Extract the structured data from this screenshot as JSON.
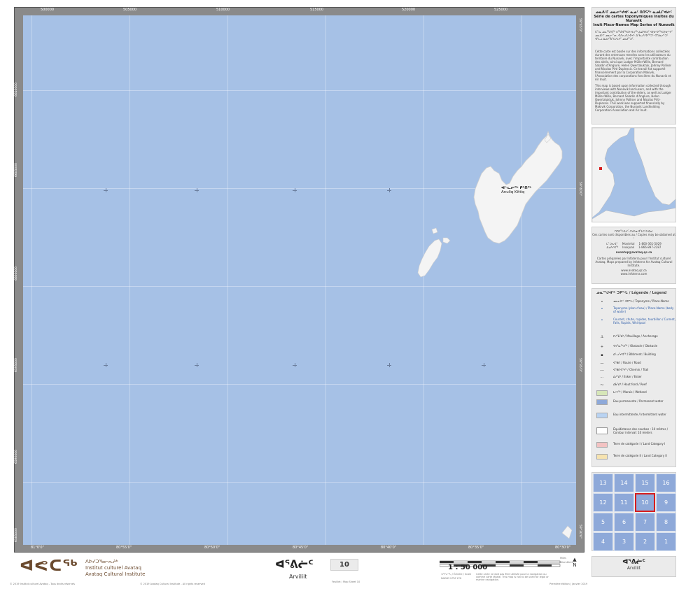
{
  "map": {
    "top_ticks": [
      "500000",
      "505000",
      "510000",
      "515000",
      "520000",
      "525000"
    ],
    "bottom_ticks": [
      "81°0'0\"",
      "80°55'0\"",
      "80°50'0\"",
      "80°45'0\"",
      "80°40'0\"",
      "80°35'0\"",
      "80°30'0\""
    ],
    "left_ticks": [
      "6610000",
      "6605000",
      "6600000",
      "6595000",
      "6590000",
      "6585000",
      "6580000"
    ],
    "right_ticks": [
      "59°45'0\"",
      "59°40'0\"",
      "59°35'0\"",
      "59°30'0\""
    ],
    "place_syllabic": "ᐊᓪᓚᓕᖅ ᑭᑦᑎᖅ",
    "place_roman": "Anuliq Kittiq"
  },
  "panel": {
    "series_title_syllabic": "ᓄᓇᕕᒻᒥ ᓄᓇᓕᕐᔪᐊᑦ ᓇᓄᑦ ᑎᑎᕋᖅ ᓇᓄᒪᒋᐊᓖᑦ",
    "series_title_fr": "Série de cartes toponymiques inuites du Nunavik",
    "series_title_en": "Inuit Place-Names Map Series of Nunavik",
    "intro_syllabic": "ᑖᓐᓇ ᓄᓇᙳᐊᖅ ᐱᙳᐊᖅᑕᐅᓯᒪᔪᖅ ᐃᓄᒃᑎᑐᑦ ᐊᑎᓕᐅᖅᑕᐅᓂᖏᑦ ᓄᓇᕕᒻᒥ ᓄᓇᓕᓐᓂ, ᐊᐱᕆᓯᒪᔭᐅᔪᑦ ᐃᖃᓗᒃᓯᐅᖅᑐᑦ ᐊᖑᓇᓱᑦᑐᑦ ᐊᒻᒪᓗ ᐃᓅᓯᖃᑦᑕᓯᒪᔪᑦ ᓄᓇᒦᑦᑐᑦ.",
    "intro_fr": "Cette carte est basée sur des informations collectées durant des entrevues menées avec les utilisateurs du territoire du Nunavik, avec l'importante contribution des aînés, ainsi que Ludger Müller-Wille, Bernard Saladin d'Anglure, Helen Qwertaluktuk, Johnny Palliser and Nicolas Pirti-Duplessis. Ce travail fut supporté financièrement par la Corporation Makivik, l'Association des corporations foncières du Nunavik et Air Inuit.",
    "intro_en": "This map is based upon information collected through interviews with Nunavik land users, and with the important contribution of the elders, as well as Ludger Müller-Wille, Bernard Saladin d'Anglure, Helen Qwertaluktuk, Johnny Palliser and Nicolas Pirti-Duplessis. This work was supported financially by Makivik Corporation, the Nunavik Landholding Corporation Association and Air Inuit.",
    "obtain_syllabic": "ᑎᑎᕋᖅᓯᒪᔪᑦ ᐱᔭᐅᓂᐊᕐᒪᑕ ᐅᕙᓂ:",
    "obtain_bi": "Ces cartes sont disponibles au / Copies may be obtained at :",
    "contact_1_label": "ᒪᓐᑐᕆᐊᓪ",
    "contact_1_city": "Montréal",
    "contact_1_phone": "1-800-361-5029",
    "contact_2_label": "ᐃᓄᒃᔪᐊᖅ",
    "contact_2_city": "Inukjuak",
    "contact_2_phone": "1-866-897-2287",
    "email": "nunatop@avataq.qc.ca",
    "prepared_by": "Cartes préparées par Infoterra pour l'Institut culturel Avataq. Maps prepared by Infoterra for Avataq Cultural Institute.",
    "website_1": "www.avataq.qc.ca",
    "website_2": "www.infoterra.com",
    "legend_title": "ᓄᓇᙳᐊᖅ ᑐᑭᖓ / Légende / Legend",
    "legend": [
      {
        "text": "ᓄᓇᓕᐅᑉ ᐊᑎᖓ / Toponyme / Place-Name",
        "style": "normal",
        "symbol": "•"
      },
      {
        "text": "Toponyme (plan d'eau) / Place-Name (body of water)",
        "style": "blue",
        "symbol": "•"
      },
      {
        "text": "Courant, chute, rapides, tourbillon / Current, Falls, Rapids, Whirlpool",
        "style": "blue",
        "symbol": "•"
      },
      {
        "text": "ᑭᓯᖃᕐᕕᒃ / Mouillage / Anchorage",
        "style": "normal",
        "symbol": "⚓"
      },
      {
        "text": "ᐊᔪᕐᓇᖅᑐᖅ / Obstacle / Obstacle",
        "style": "normal",
        "symbol": "+"
      },
      {
        "text": "ᐃᒡᓗᕐᔪᐊᖅ / Bâtiment / Building",
        "style": "normal",
        "symbol": "▪"
      },
      {
        "text": "ᐊᖁᑎ / Route / Road",
        "style": "normal",
        "symbol": "—"
      },
      {
        "text": "ᐊᖁᑎᐊᕐᔪᒃ / Chemin / Trail",
        "style": "normal",
        "symbol": "---"
      },
      {
        "text": "ᐃᓯᕐᕕᒃ / Esker / Esker",
        "style": "normal",
        "symbol": "⋯"
      },
      {
        "text": "ᐃᑳᕐᕕᒃ / Haut fond / Reef",
        "style": "normal",
        "symbol": "⁓"
      },
      {
        "text": "ᒪᓱᓯᖅ / Marais / Wetland",
        "style": "normal",
        "symbol": ""
      },
      {
        "text": "Eau permanente / Permanent water",
        "style": "normal",
        "symbol": ""
      },
      {
        "text": "Eau intermittente / Intermittent water",
        "style": "normal",
        "symbol": ""
      },
      {
        "text": "Équidistance des courbes : 10 mètres / Contour interval: 10 meters",
        "style": "normal",
        "symbol": ""
      },
      {
        "text": "Terre de catégorie I / Land Category I",
        "style": "normal",
        "symbol": ""
      },
      {
        "text": "Terre de catégorie II / Land Category II",
        "style": "normal",
        "symbol": ""
      }
    ],
    "legend_colors": {
      "wetland": "#d6e6b8",
      "permanent": "#8ea9d9",
      "intermittent": "#b9d3f2",
      "cat1": "#f3c2c2",
      "cat2": "#f6e3b0"
    }
  },
  "index": {
    "rows": [
      [
        "13",
        "14",
        "15",
        "16"
      ],
      [
        "12",
        "11",
        "10",
        "9"
      ],
      [
        "5",
        "6",
        "7",
        "8"
      ],
      [
        "4",
        "3",
        "2",
        "1"
      ]
    ],
    "current": "10",
    "current_color": "#d71d1d",
    "cell_color": "#8ea9d9"
  },
  "bottom": {
    "org_syllabic": "ᐱᐅᓯᑐᖃᓕᕆᔨᒃ",
    "org_fr": "Institut culturel Avataq",
    "org_en": "Avataq Cultural Institute",
    "map_name_syllabic": "ᐊᕐᕕᓖᑦ",
    "map_name_roman": "Arviliit",
    "sheet_number": "10",
    "scale": "1 : 50 000",
    "scale_caption": "ᐊᖏᓂᖓ / Échelle / Scale",
    "scale_unit_top": "Miles",
    "scale_unit_bottom": "Kilomètres",
    "datum": "NAD83 UTM 17N",
    "side_syllabic": "ᐊᕐᕕᓖᑦ",
    "side_roman": "Arviliit",
    "copyright_left": "© 2019 Institut culturel Avataq - Tous droits réservés",
    "copyright_mid": "© 2019 Avataq Cultural Institute - All rights reserved",
    "edition": "1st Edition | January 2019",
    "edition_fr": "Première édition | Janvier 2019",
    "disclaimer": "Cette carte ne doit pas être utilisée pour la navigation ou comme carte légale. This map is not to be used for legal or marine navigation.",
    "map_sheet_label": "Feuillet / Map Sheet 10"
  }
}
